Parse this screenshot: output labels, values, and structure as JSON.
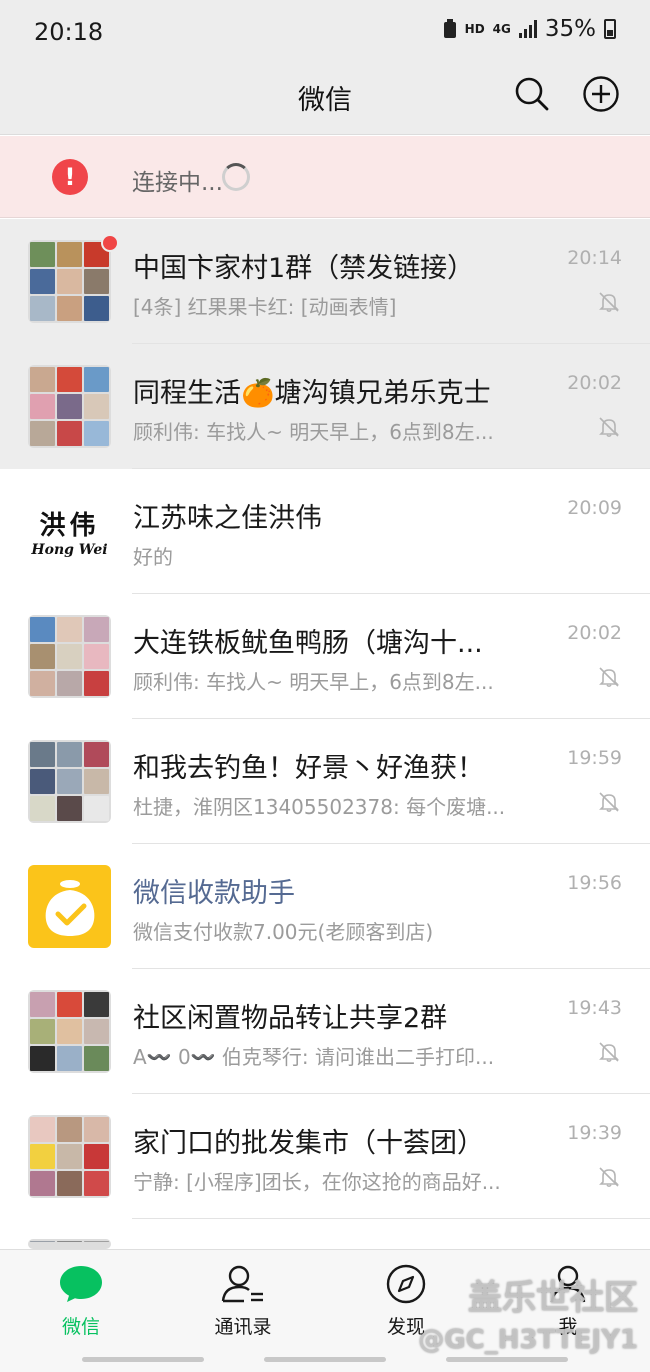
{
  "status_bar": {
    "time": "20:18",
    "hd": "HD",
    "network": "4G",
    "battery": "35%"
  },
  "header": {
    "title": "微信"
  },
  "connection": {
    "text": "连接中..."
  },
  "chats": [
    {
      "name": "中国卞家村1群（禁发链接）",
      "preview": "[4条] 红果果卡红: [动画表情]",
      "time": "20:14"
    },
    {
      "name": "同程生活🍊塘沟镇兄弟乐克士",
      "preview": "顾利伟: 车找人~ 明天早上，6点到8左...",
      "time": "20:02"
    },
    {
      "name": "江苏味之佳洪伟",
      "preview": "好的",
      "time": "20:09",
      "avatar_big": "洪伟",
      "avatar_small": "Hong Wei"
    },
    {
      "name": "大连铁板鱿鱼鸭肠（塘沟十...",
      "preview": "顾利伟: 车找人~ 明天早上，6点到8左...",
      "time": "20:02"
    },
    {
      "name": "和我去钓鱼！好景丶好渔获！",
      "preview": "杜捷，淮阴区13405502378: 每个废塘...",
      "time": "19:59"
    },
    {
      "name": "微信收款助手",
      "preview": "微信支付收款7.00元(老顾客到店)",
      "time": "19:56"
    },
    {
      "name": "社区闲置物品转让共享2群",
      "preview": "A〰️ 0〰️ 伯克琴行: 请问谁出二手打印...",
      "time": "19:43"
    },
    {
      "name": "家门口的批发集市（十荟团）",
      "preview": "宁静: [小程序]团长，在你这抢的商品好...",
      "time": "19:39"
    }
  ],
  "nav": {
    "chats": "微信",
    "contacts": "通讯录",
    "discover": "发现",
    "me": "我"
  },
  "watermark": {
    "line1": "盖乐世社区",
    "line2": "@GC_H3TTEJY1"
  },
  "colors": {
    "accent": "#07c160",
    "alert": "#f0454a",
    "service_name": "#556a92",
    "unread": "#f04646"
  },
  "icons": {
    "header": [
      "search-icon",
      "add-circle-icon"
    ],
    "connection": [
      "error-icon",
      "loading-spinner-icon"
    ],
    "row": [
      "bell-muted-icon"
    ],
    "nav": [
      "chat-bubble-icon",
      "contacts-icon",
      "compass-icon",
      "person-icon"
    ]
  }
}
